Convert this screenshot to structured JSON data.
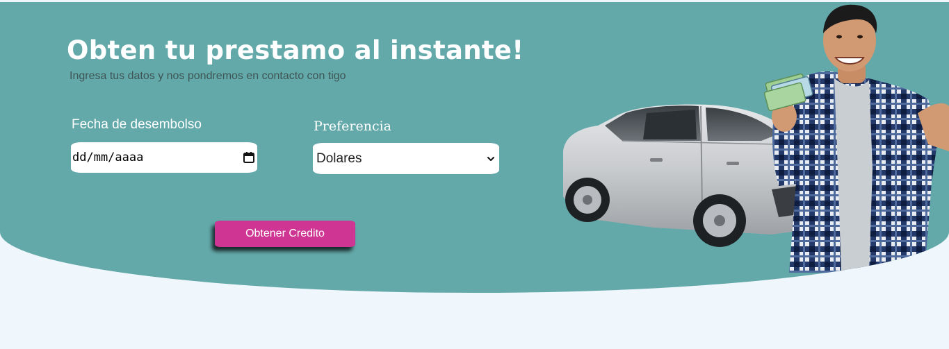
{
  "hero": {
    "title": "Obten tu prestamo al instante!",
    "subtitle": "Ingresa tus datos y nos pondremos en contacto con tigo",
    "background_color": "#64a9aa",
    "page_background_color": "#f0f7fc"
  },
  "form": {
    "date_label": "Fecha de desembolso",
    "date_placeholder": "dd/mm/aaaa",
    "date_icon": "calendar-icon",
    "preference_label": "Preferencia",
    "preference_selected": "Dolares",
    "preference_icon": "chevron-down-icon"
  },
  "cta": {
    "label": "Obtener Credito",
    "color": "#cf3592"
  },
  "illustration": {
    "description_icon": "car-and-person-icon"
  }
}
